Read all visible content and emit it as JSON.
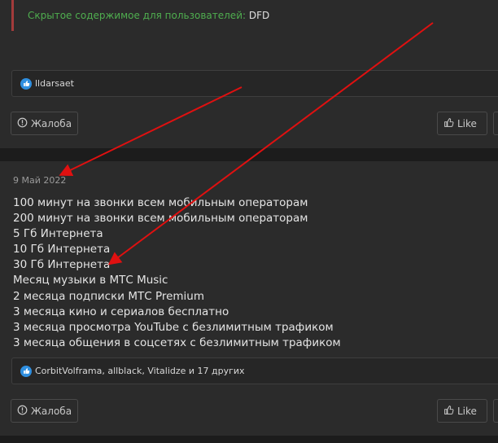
{
  "post1": {
    "hidden_label": "Скрытое содержимое для пользователей: ",
    "hidden_value": "DFD",
    "likes_text": "lldarsaet",
    "report_label": "Жалоба",
    "like_label": "Like"
  },
  "post2": {
    "date": "9 Май 2022",
    "lines": [
      "100 минут на звонки всем мобильным операторам",
      "200 минут на звонки всем мобильным операторам",
      "5 Гб Интернета",
      "10 Гб Интернета",
      "30 Гб Интернета",
      "Месяц музыки в МТС Music",
      "2 месяца подписки МТС Premium",
      "3 месяца кино и сериалов бесплатно",
      "3 месяца просмотра YouTube с безлимитным трафиком",
      "3 месяца общения в соцсетях с безлимитным трафиком"
    ],
    "likes_text": "CorbitVolframa, allblack, Vitalidze и 17 других",
    "report_label": "Жалоба",
    "like_label": "Like"
  },
  "colors": {
    "background": "#1c1c1c",
    "post_bg": "#2b2b2b",
    "hidden_label": "#4fae4f",
    "hidden_border": "#a33b3b",
    "like_badge": "#2f8fe0",
    "annotation_arrow": "#e01010"
  },
  "icons": {
    "report": "exclamation-circle-icon",
    "like": "thumbs-up-icon",
    "like_badge": "like-badge-icon"
  }
}
